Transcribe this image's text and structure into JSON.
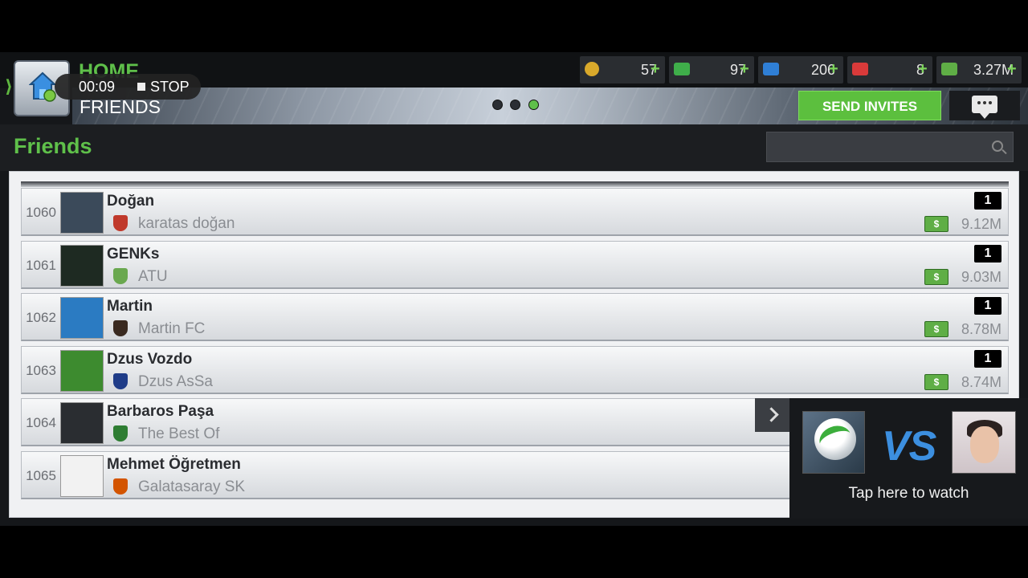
{
  "header": {
    "home_label": "HOME",
    "section_label": "FRIENDS",
    "recording": {
      "time": "00:09",
      "stop_label": "STOP"
    },
    "send_invites_label": "SEND INVITES"
  },
  "currencies": [
    {
      "name": "tokens",
      "value": "57",
      "color": "#d9a92b"
    },
    {
      "name": "cash-green",
      "value": "97",
      "color": "#3fae4a"
    },
    {
      "name": "energy",
      "value": "206",
      "color": "#2f7fd6"
    },
    {
      "name": "health",
      "value": "8",
      "color": "#d93a3a"
    },
    {
      "name": "money",
      "value": "3.27M",
      "color": "#5fae46"
    }
  ],
  "panel": {
    "title": "Friends",
    "search_placeholder": ""
  },
  "rows": [
    {
      "rank": "1060",
      "name": "Doğan",
      "club": "karatas doğan",
      "badge": "1",
      "value": "9.12M",
      "crest": "#c0392b",
      "avatar": "#3b4a5a"
    },
    {
      "rank": "1061",
      "name": "GENKs",
      "club": "ATU",
      "badge": "1",
      "value": "9.03M",
      "crest": "#6aa84f",
      "avatar": "#1e2a22"
    },
    {
      "rank": "1062",
      "name": "Martin",
      "club": "Martin FC",
      "badge": "1",
      "value": "8.78M",
      "crest": "#3a2a20",
      "avatar": "#2b7bc2"
    },
    {
      "rank": "1063",
      "name": "Dzus Vozdo",
      "club": "Dzus AsSa",
      "badge": "1",
      "value": "8.74M",
      "crest": "#1f3c88",
      "avatar": "#3d8b2f"
    },
    {
      "rank": "1064",
      "name": "Barbaros Paşa",
      "club": "The Best Of",
      "badge": "",
      "value": "",
      "crest": "#2e7d32",
      "avatar": "#2a2d31"
    },
    {
      "rank": "1065",
      "name": "Mehmet Öğretmen",
      "club": "Galatasaray SK",
      "badge": "",
      "value": "",
      "crest": "#d35400",
      "avatar": "#f2f2f2"
    }
  ],
  "match_popup": {
    "vs_label": "VS",
    "caption": "Tap here to watch"
  },
  "icons": {
    "search": "search-icon",
    "chat": "chat-icon",
    "cash": "cash-icon",
    "home": "home-icon"
  }
}
